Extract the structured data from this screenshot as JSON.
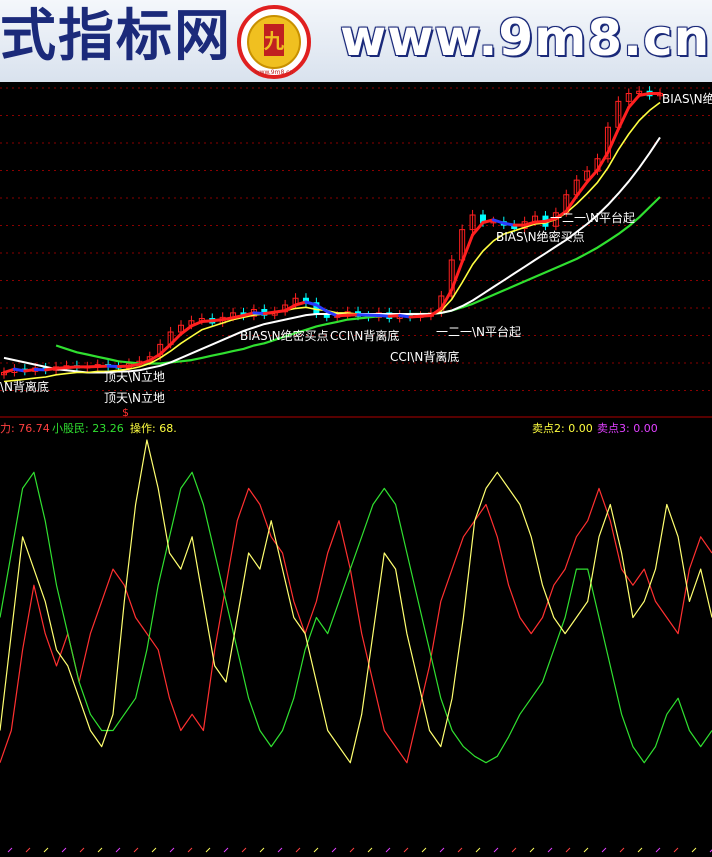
{
  "banner": {
    "left_text": "式指标网",
    "right_text": "www.9m8.cn",
    "logo_text": "九",
    "logo_caption": "www.9m8.cn"
  },
  "colors": {
    "background": "#000000",
    "up_candle": "#ff2020",
    "down_candle": "#00ffff",
    "ma_red": "#ff2020",
    "ma_blue": "#2a3cff",
    "ma_yellow": "#ffff40",
    "ma_white": "#ffffff",
    "ma_green": "#30e030",
    "grid": "#8a0000"
  },
  "chart_data": [
    {
      "type": "line",
      "panel": "price",
      "grid": true,
      "series": [
        {
          "values": [
            2.0,
            2.3,
            2.1,
            2.4,
            2.2,
            2.5,
            2.6,
            2.4,
            2.5,
            2.7,
            2.5,
            2.4,
            2.8,
            3.0,
            3.4,
            4.5,
            5.6,
            6.2,
            6.6,
            6.8,
            6.4,
            6.9,
            7.3,
            7.0,
            7.6,
            7.1,
            7.4,
            8.0,
            8.6,
            8.2,
            7.2,
            6.9,
            7.0,
            7.4,
            7.0,
            6.9,
            7.3,
            6.8,
            7.1,
            6.9,
            7.0,
            7.3,
            8.8,
            12.0,
            14.7,
            16.0,
            15.3,
            15.4,
            15.1,
            14.8,
            15.4,
            15.9,
            15.0,
            16.2,
            17.8,
            19.1,
            19.9,
            21.0,
            23.8,
            26.1,
            26.8,
            27.0,
            26.6,
            26.8
          ]
        },
        {
          "values": [
            1.2,
            1.3,
            1.4,
            1.5,
            1.6,
            1.8,
            1.9,
            2.0,
            2.0,
            2.1,
            2.1,
            2.2,
            2.3,
            2.5,
            2.8,
            3.3,
            3.9,
            4.6,
            5.2,
            5.8,
            6.1,
            6.4,
            6.7,
            6.9,
            7.1,
            7.2,
            7.3,
            7.5,
            7.7,
            7.8,
            7.6,
            7.5,
            7.3,
            7.3,
            7.2,
            7.1,
            7.1,
            7.0,
            7.0,
            7.0,
            7.0,
            7.1,
            7.5,
            8.5,
            10.0,
            11.6,
            12.8,
            13.7,
            14.3,
            14.6,
            14.9,
            15.2,
            15.3,
            15.6,
            16.2,
            17.0,
            17.9,
            18.9,
            20.2,
            21.8,
            23.2,
            24.4,
            25.3,
            26.0
          ]
        },
        {
          "values": [
            3.3,
            3.1,
            2.9,
            2.7,
            2.5,
            2.3,
            2.2,
            2.1,
            2.0,
            2.0,
            2.0,
            2.1,
            2.1,
            2.2,
            2.4,
            2.6,
            2.9,
            3.3,
            3.7,
            4.1,
            4.5,
            4.9,
            5.3,
            5.7,
            6.0,
            6.3,
            6.5,
            6.7,
            6.9,
            7.1,
            7.2,
            7.2,
            7.2,
            7.2,
            7.2,
            7.2,
            7.2,
            7.2,
            7.2,
            7.2,
            7.2,
            7.2,
            7.3,
            7.5,
            7.9,
            8.4,
            9.0,
            9.6,
            10.2,
            10.8,
            11.4,
            12.0,
            12.6,
            13.2,
            13.8,
            14.5,
            15.2,
            16.0,
            16.9,
            17.9,
            19.0,
            20.2,
            21.5,
            22.9
          ]
        },
        {
          "values": [
            null,
            null,
            null,
            null,
            null,
            4.4,
            4.1,
            3.8,
            3.6,
            3.4,
            3.2,
            3.0,
            2.9,
            2.8,
            2.8,
            2.8,
            2.9,
            3.0,
            3.1,
            3.3,
            3.5,
            3.7,
            3.9,
            4.1,
            4.4,
            4.6,
            4.9,
            5.2,
            5.5,
            5.8,
            6.1,
            6.3,
            6.5,
            6.7,
            6.8,
            6.9,
            7.0,
            7.1,
            7.1,
            7.2,
            7.2,
            7.2,
            7.3,
            7.5,
            7.8,
            8.1,
            8.5,
            8.9,
            9.3,
            9.7,
            10.1,
            10.5,
            10.9,
            11.3,
            11.7,
            12.1,
            12.6,
            13.1,
            13.7,
            14.3,
            15.0,
            15.8,
            16.7,
            17.6
          ]
        }
      ],
      "annotations": [
        "顶天\\N立地",
        "BIAS\\N绝密买点",
        "CCI\\N背离底",
        "一二一\\N平台起",
        "BIAS\\N绝密买点",
        "CCI\\N背离底",
        "一二一\\N平台起",
        "BIAS\\N绝",
        "\\N背离底",
        "顶天\\N立地"
      ],
      "markers": [
        "$"
      ]
    },
    {
      "type": "line",
      "panel": "indicator",
      "grid": false,
      "legend": [
        {
          "label": "力: 76.74",
          "color": "#ff4040"
        },
        {
          "label": "小股民: 23.26",
          "color": "#30e030"
        },
        {
          "label": "操作: 68.",
          "color": "#ffff40"
        },
        {
          "label": "卖点2: 0.00",
          "color": "#ffff40"
        },
        {
          "label": "卖点3: 0.00",
          "color": "#e040ff"
        }
      ],
      "series": [
        {
          "values": [
            10,
            20,
            45,
            65,
            50,
            40,
            50,
            35,
            50,
            60,
            70,
            65,
            55,
            50,
            45,
            30,
            20,
            25,
            20,
            45,
            65,
            85,
            95,
            90,
            80,
            75,
            60,
            50,
            60,
            75,
            85,
            70,
            50,
            35,
            20,
            15,
            10,
            25,
            40,
            60,
            70,
            80,
            85,
            90,
            80,
            65,
            55,
            50,
            55,
            65,
            70,
            80,
            85,
            95,
            85,
            70,
            65,
            70,
            60,
            55,
            50,
            70,
            80,
            75
          ]
        },
        {
          "values": [
            55,
            75,
            95,
            100,
            85,
            65,
            50,
            35,
            25,
            20,
            20,
            25,
            30,
            45,
            65,
            80,
            95,
            100,
            90,
            75,
            60,
            45,
            30,
            20,
            15,
            20,
            30,
            45,
            55,
            50,
            60,
            70,
            80,
            90,
            95,
            90,
            75,
            60,
            45,
            30,
            20,
            15,
            12,
            10,
            12,
            18,
            25,
            30,
            35,
            45,
            55,
            70,
            70,
            55,
            40,
            25,
            15,
            10,
            15,
            25,
            30,
            20,
            15,
            20
          ]
        },
        {
          "values": [
            20,
            50,
            80,
            70,
            60,
            45,
            40,
            30,
            20,
            15,
            25,
            60,
            90,
            110,
            95,
            75,
            70,
            80,
            60,
            40,
            35,
            55,
            75,
            70,
            85,
            70,
            55,
            50,
            35,
            20,
            15,
            10,
            25,
            50,
            75,
            70,
            50,
            35,
            20,
            15,
            30,
            55,
            85,
            95,
            100,
            95,
            90,
            80,
            65,
            55,
            50,
            55,
            60,
            80,
            90,
            75,
            55,
            60,
            70,
            90,
            80,
            60,
            70,
            55
          ]
        }
      ]
    }
  ]
}
